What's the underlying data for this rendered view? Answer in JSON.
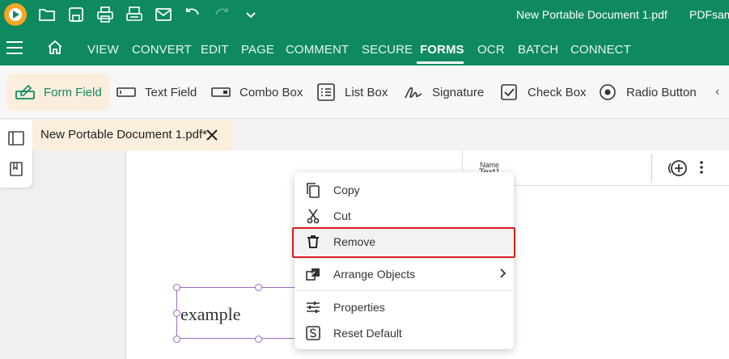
{
  "titlebar": {
    "document_title": "New Portable Document 1.pdf",
    "app_name": "PDFsam"
  },
  "menubar": {
    "items": [
      "VIEW",
      "CONVERT",
      "EDIT",
      "PAGE",
      "COMMENT",
      "SECURE",
      "FORMS",
      "OCR",
      "BATCH",
      "CONNECT"
    ],
    "active": "FORMS"
  },
  "ribbon": {
    "tools": [
      "Form Field",
      "Text Field",
      "Combo Box",
      "List Box",
      "Signature",
      "Check Box",
      "Radio Button"
    ],
    "active": "Form Field"
  },
  "tab": {
    "label": "New Portable Document 1.pdf*"
  },
  "field_panel": {
    "name_label": "Name",
    "name_value": "Text1"
  },
  "page": {
    "text_field_value": "example"
  },
  "context_menu": {
    "items": [
      "Copy",
      "Cut",
      "Remove",
      "Arrange Objects",
      "Properties",
      "Reset Default"
    ],
    "highlighted": "Remove"
  },
  "colors": {
    "brand_green": "#0f8a5f",
    "active_tab_bg": "#fbeedd",
    "highlight_red": "#d91f1f",
    "field_border": "#9b6cc0"
  }
}
